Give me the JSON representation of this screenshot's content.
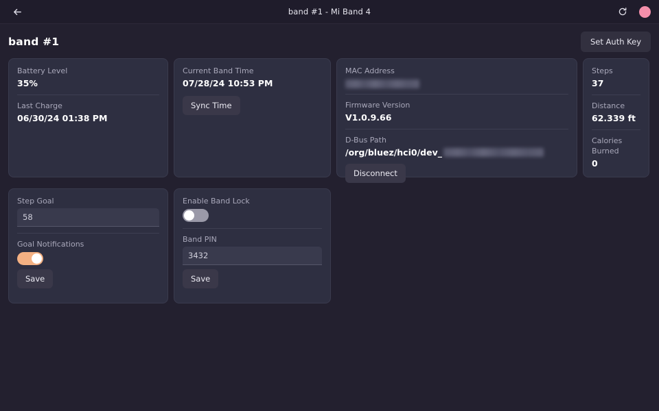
{
  "titlebar": {
    "back_icon": "arrow-left-icon",
    "title": "band #1 - Mi Band 4",
    "refresh_icon": "refresh-icon",
    "avatar_icon": "avatar-circle",
    "avatar_color": "#f48fab"
  },
  "header": {
    "page_title": "band #1",
    "auth_button": "Set Auth Key"
  },
  "colors": {
    "page_background": "#23202f",
    "titlebar_background": "#1f1c2b",
    "card_background": "#2e2f41",
    "card_border": "#3a3b4e",
    "accent_toggle_on": "#f4b183",
    "toggle_off": "#9a99a8",
    "button_background": "#3a3849",
    "label_text": "#a9a8ba",
    "value_text": "#ffffff"
  },
  "cards": {
    "battery": {
      "fields": [
        {
          "label": "Battery Level",
          "value": "35%"
        },
        {
          "label": "Last Charge",
          "value": "06/30/24 01:38 PM"
        }
      ]
    },
    "band_time": {
      "label": "Current Band Time",
      "value": "07/28/24 10:53 PM",
      "sync_button": "Sync Time"
    },
    "device": {
      "mac_label": "MAC Address",
      "mac_value": "",
      "mac_redacted": true,
      "firmware_label": "Firmware Version",
      "firmware_value": "V1.0.9.66",
      "dbus_label": "D-Bus Path",
      "dbus_value_prefix": "/org/bluez/hci0/dev_",
      "dbus_redacted": true,
      "disconnect_button": "Disconnect"
    },
    "activity": {
      "fields": [
        {
          "label": "Steps",
          "value": "37"
        },
        {
          "label": "Distance",
          "value": "62.339 ft"
        },
        {
          "label": "Calories Burned",
          "value": "0"
        }
      ]
    },
    "step_goal": {
      "goal_label": "Step Goal",
      "goal_value": "58",
      "goal_placeholder": "Step Goal",
      "notifications_label": "Goal Notifications",
      "notifications_on": true,
      "save_button": "Save"
    },
    "band_lock": {
      "lock_label": "Enable Band Lock",
      "lock_on": false,
      "pin_label": "Band PIN",
      "pin_value": "3432",
      "pin_placeholder": "Band PIN",
      "save_button": "Save"
    }
  }
}
